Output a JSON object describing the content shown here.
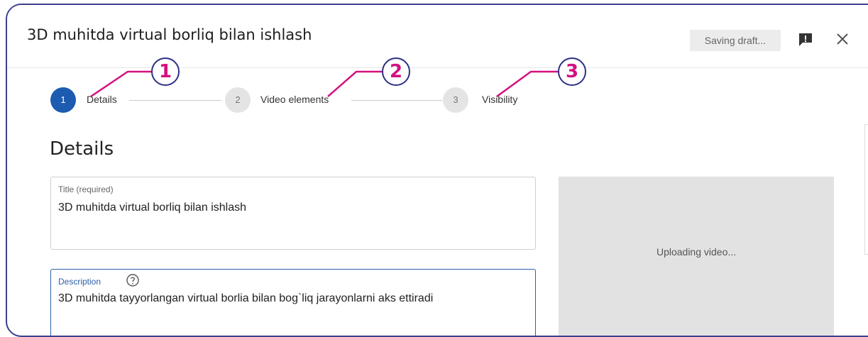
{
  "header": {
    "title": "3D muhitda virtual borliq bilan ishlash",
    "status": "Saving draft...",
    "icons": {
      "feedback": "feedback-icon",
      "close": "close-icon"
    }
  },
  "stepper": {
    "steps": [
      {
        "number": "1",
        "label": "Details",
        "callout": "1",
        "state": "active"
      },
      {
        "number": "2",
        "label": "Video elements",
        "callout": "2",
        "state": "idle"
      },
      {
        "number": "3",
        "label": "Visibility",
        "callout": "3",
        "state": "idle"
      }
    ]
  },
  "main": {
    "heading": "Details",
    "title_field": {
      "label": "Title (required)",
      "value": "3D muhitda virtual borliq bilan ishlash"
    },
    "description_field": {
      "label": "Description",
      "value": "3D muhitda tayyorlangan virtual borlia bilan bog`liq jarayonlarni aks ettiradi"
    },
    "preview": {
      "status": "Uploading video..."
    }
  },
  "colors": {
    "accent": "#1d5bb0",
    "callout_text": "#d4117f",
    "frame_border": "#3b3f8f"
  }
}
